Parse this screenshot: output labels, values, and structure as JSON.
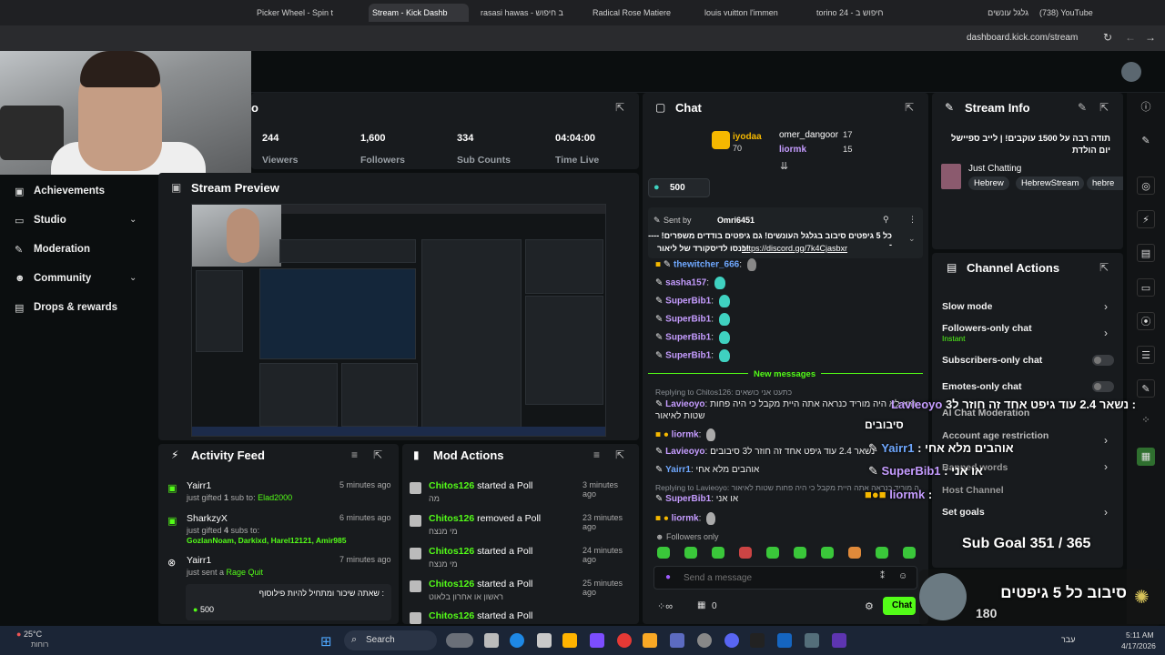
{
  "browser": {
    "tabs": [
      {
        "label": "Picker Wheel - Spin t",
        "color": "#f5c518"
      },
      {
        "label": "Stream - Kick Dashb",
        "color": "#53fc18"
      },
      {
        "label": "rasasi hawas - ב חיפוש",
        "color": "#4285f4"
      },
      {
        "label": "Radical Rose Matiere",
        "color": "#e91e63"
      },
      {
        "label": "louis vuitton l'immen",
        "color": "#4285f4"
      },
      {
        "label": "torino 24 - חיפוש ב",
        "color": "#4285f4"
      },
      {
        "label": "גלגל עונשים",
        "color": "#e91e63"
      },
      {
        "label": "(738) YouTube",
        "color": "#ff0000"
      }
    ],
    "url": "dashboard.kick.com/stream"
  },
  "sidebar": {
    "items": [
      {
        "label": "Achievements",
        "icon": "trophy-icon"
      },
      {
        "label": "Studio",
        "icon": "studio-icon",
        "chevron": true
      },
      {
        "label": "Moderation",
        "icon": "wrench-icon"
      },
      {
        "label": "Community",
        "icon": "people-icon",
        "chevron": true
      },
      {
        "label": "Drops & rewards",
        "icon": "gift-icon"
      }
    ]
  },
  "stats": {
    "title_partial": "o",
    "items": [
      {
        "value": "244",
        "label": "Viewers"
      },
      {
        "value": "1,600",
        "label": "Followers"
      },
      {
        "value": "334",
        "label": "Sub Counts"
      },
      {
        "value": "04:04:00",
        "label": "Time Live"
      }
    ]
  },
  "preview": {
    "title": "Stream Preview"
  },
  "activity": {
    "title": "Activity Feed",
    "items": [
      {
        "user": "Yairr1",
        "text_a": "just gifted ",
        "num": "1",
        "text_b": " sub to: ",
        "target": "Elad2000",
        "time": "5 minutes ago"
      },
      {
        "user": "SharkzyX",
        "text_a": "just gifted ",
        "num": "4",
        "text_b": " subs to:",
        "target": "GozlanNoam, Darkixd, Harel12121, Amir985",
        "time": "6 minutes ago"
      },
      {
        "user": "Yairr1",
        "text_a": "just sent a ",
        "num": "",
        "text_b": "",
        "target": "Rage Quit",
        "time": "7 minutes ago"
      }
    ],
    "message": ": שאתה שיכור ומתחיל להיות פילוסוף",
    "amount": "500"
  },
  "mod": {
    "title": "Mod Actions",
    "items": [
      {
        "user": "Chitos126",
        "action": "started a Poll",
        "sub": "מה",
        "time": "3 minutes ago"
      },
      {
        "user": "Chitos126",
        "action": "removed a Poll",
        "sub": "מי מנצח",
        "time": "23 minutes ago"
      },
      {
        "user": "Chitos126",
        "action": "started a Poll",
        "sub": "מי מנצח",
        "time": "24 minutes ago"
      },
      {
        "user": "Chitos126",
        "action": "started a Poll",
        "sub": "ראשון או אחרון בלאוט",
        "time": "25 minutes ago"
      },
      {
        "user": "Chitos126",
        "action": "started a Poll",
        "sub": "",
        "time": ""
      }
    ]
  },
  "chat": {
    "title": "Chat",
    "leaders": [
      {
        "name": "iyodaa",
        "count": "70"
      },
      {
        "name": "omer_dangoor",
        "count": "17"
      },
      {
        "name": "liormk",
        "count": "15"
      }
    ],
    "kicks": "500",
    "pinned": {
      "sent_by_label": "Sent by",
      "sender": "Omri6451",
      "text": "כל 5 גיפטים סיבוב בגלגל העונשים! גם גיפטים בודדים משפרים! -----",
      "text2": "כנסו לדיסקורד של ליאור!",
      "link": "https://discord.gg/7k4Cjasbxr"
    },
    "messages": [
      {
        "user": "thewitcher_666",
        "color": "#6fa8ff",
        "text": ""
      },
      {
        "user": "sasha157",
        "color": "#c59cff",
        "text": ""
      },
      {
        "user": "SuperBib1",
        "color": "#c59cff",
        "text": ""
      },
      {
        "user": "SuperBib1",
        "color": "#c59cff",
        "text": ""
      },
      {
        "user": "SuperBib1",
        "color": "#c59cff",
        "text": ""
      },
      {
        "user": "SuperBib1",
        "color": "#c59cff",
        "text": ""
      }
    ],
    "new_messages": "New messages",
    "reply1": "Replying to Chitos126: כתעט אני כושאים",
    "msg_lavie1_user": "Lavieoyo",
    "msg_lavie1": "הוא לא היה מוריד כנראה אתה היית מקבל כי היה פחות שטות לאיאור",
    "msg_liormk": "liormk",
    "msg_lavie2_user": "Lavieoyo",
    "msg_lavie2": "נשאר 2.4 עוד גיפט אחד זה חוזר ל3 סיבובים",
    "msg_yairr1_user": "Yairr1",
    "msg_yairr1": "אוהבים מלא אחי",
    "reply2": "Replying to Lavieoyo: הוא לא היה מוריד כנראה אתה היית מקבל כי היה פחות שטות לאיאור",
    "msg_superbib_user": "SuperBib1",
    "msg_superbib": "או אני",
    "msg_liormk2": "liormk",
    "followers_only": "Followers only",
    "input_placeholder": "Send a message",
    "viewer_count": "0",
    "chat_button": "Chat"
  },
  "stream_info": {
    "title": "Stream Info",
    "stream_title": "תודה רבה על 1500 עוקבים! | לייב ספיישל יום הולדת",
    "category": "Just Chatting",
    "tags": [
      "Hebrew",
      "HebrewStream",
      "hebre"
    ]
  },
  "channel_actions": {
    "title": "Channel Actions",
    "items": [
      {
        "label": "Slow mode",
        "sub": ""
      },
      {
        "label": "Followers-only chat",
        "sub": "Instant"
      },
      {
        "label": "Subscribers-only chat",
        "sub": ""
      },
      {
        "label": "Emotes-only chat",
        "sub": ""
      },
      {
        "label": "AI Chat Moderation",
        "sub": ""
      },
      {
        "label": "Account age restriction",
        "sub": ""
      },
      {
        "label": "Banned words",
        "sub": ""
      },
      {
        "label": "Host Channel",
        "sub": ""
      },
      {
        "label": "Set goals",
        "sub": ""
      }
    ]
  },
  "overlay": {
    "line1_user": "Lavieoyo",
    "line1": ": נשאר 2.4 עוד גיפט אחד זה חוזר ל3",
    "line1b": "סיבובים",
    "line2_user": "Yairr1",
    "line2": ": אוהבים מלא אחי",
    "line3_user": "SuperBib1",
    "line3": ": או אני",
    "line4_user": "liormk",
    "sub_goal": "Sub Goal 351 / 365",
    "wheel_text": "סיבוב כל 5 גיפטים",
    "wheel_num": "180"
  },
  "taskbar": {
    "temp": "25°C",
    "weather": "רוחות",
    "search": "Search",
    "lang": "עבר",
    "time": "5:11 AM",
    "date": "4/17/2026"
  }
}
